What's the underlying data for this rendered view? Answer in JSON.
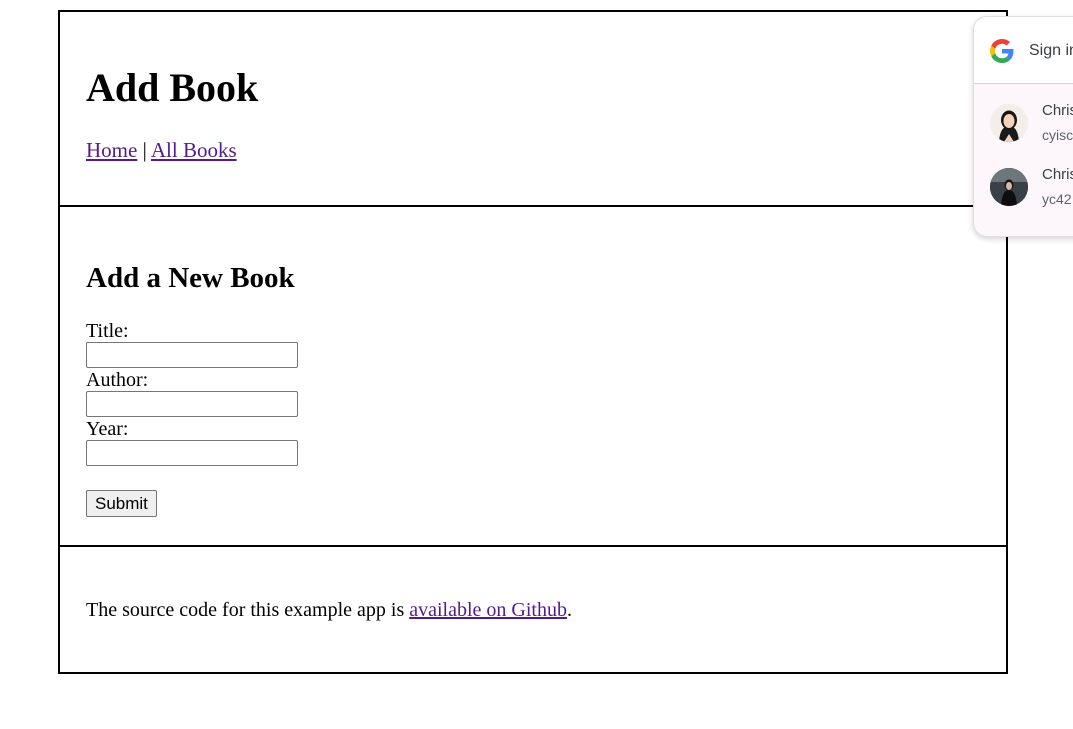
{
  "header": {
    "title": "Add Book",
    "nav_home": "Home",
    "nav_separator": "|",
    "nav_all_books": "All Books"
  },
  "form": {
    "title": "Add a New Book",
    "title_label": "Title:",
    "title_value": "",
    "author_label": "Author:",
    "author_value": "",
    "year_label": "Year:",
    "year_value": "",
    "submit_label": "Submit"
  },
  "footer": {
    "text_before": "The source code for this example app is ",
    "link_text": "available on Github",
    "text_after": "."
  },
  "google_popup": {
    "title": "Sign in",
    "accounts": [
      {
        "name": "Chris",
        "email": "cyisc"
      },
      {
        "name": "Chris",
        "email": "yc42"
      }
    ]
  },
  "colors": {
    "link": "#551a8b",
    "border": "#000000",
    "popup_bg": "#fdf7fb"
  }
}
